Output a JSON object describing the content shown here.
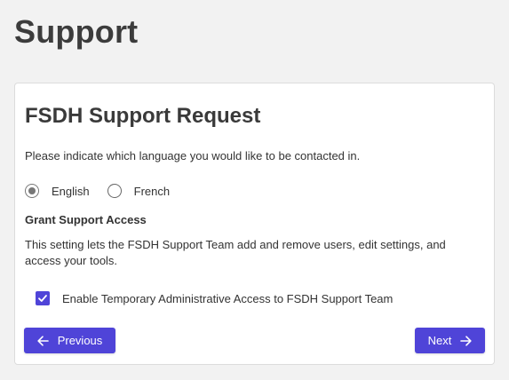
{
  "page": {
    "title": "Support"
  },
  "card": {
    "title": "FSDH Support Request",
    "prompt": "Please indicate which language you would like to be contacted in.",
    "language_options": [
      {
        "label": "English",
        "selected": true
      },
      {
        "label": "French",
        "selected": false
      }
    ],
    "section_heading": "Grant Support Access",
    "section_description": "This setting lets the FSDH Support Team add and remove users, edit settings, and access your tools.",
    "checkbox": {
      "label": "Enable Temporary Administrative Access to FSDH Support Team",
      "checked": true
    }
  },
  "buttons": {
    "previous_label": "Previous",
    "previous_icon": "arrow-left-icon",
    "next_label": "Next",
    "next_icon": "arrow-right-icon"
  },
  "colors": {
    "accent": "#4f44d8",
    "background": "#f2f2f2",
    "card": "#ffffff"
  }
}
